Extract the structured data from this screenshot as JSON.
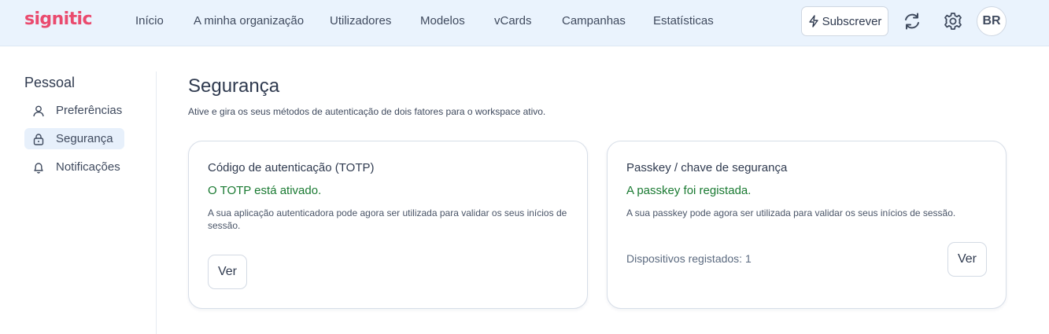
{
  "brand": {
    "name": "signitic",
    "color": "#ea4a6e"
  },
  "nav": {
    "items": [
      "Início",
      "A minha organização",
      "Utilizadores",
      "Modelos",
      "vCards",
      "Campanhas",
      "Estatísticas"
    ]
  },
  "header": {
    "subscribe_label": "Subscrever",
    "subscribe_icon": "lightning-icon",
    "sync_icon": "sync-icon",
    "settings_icon": "gear-icon",
    "avatar_initials": "BR"
  },
  "sidebar": {
    "title": "Pessoal",
    "items": [
      {
        "label": "Preferências",
        "icon": "user-icon",
        "active": false
      },
      {
        "label": "Segurança",
        "icon": "lock-icon",
        "active": true
      },
      {
        "label": "Notificações",
        "icon": "bell-icon",
        "active": false
      }
    ]
  },
  "main": {
    "title": "Segurança",
    "description": "Ative e gira os seus métodos de autenticação de dois fatores para o workspace ativo.",
    "cards": [
      {
        "title": "Código de autenticação (TOTP)",
        "status": "O TOTP está ativado.",
        "text": "A sua aplicação autenticadora pode agora ser utilizada para validar os seus inícios de sessão.",
        "button": "Ver"
      },
      {
        "title": "Passkey / chave de segurança",
        "status": "A passkey foi registada.",
        "text": "A sua passkey pode agora ser utilizada para validar os seus inícios de sessão.",
        "meta": "Dispositivos registados: 1",
        "button": "Ver"
      }
    ]
  },
  "colors": {
    "topbar_bg": "#eaf3fd",
    "status_green": "#1a7a32",
    "active_item_bg": "#e7f0fb"
  }
}
